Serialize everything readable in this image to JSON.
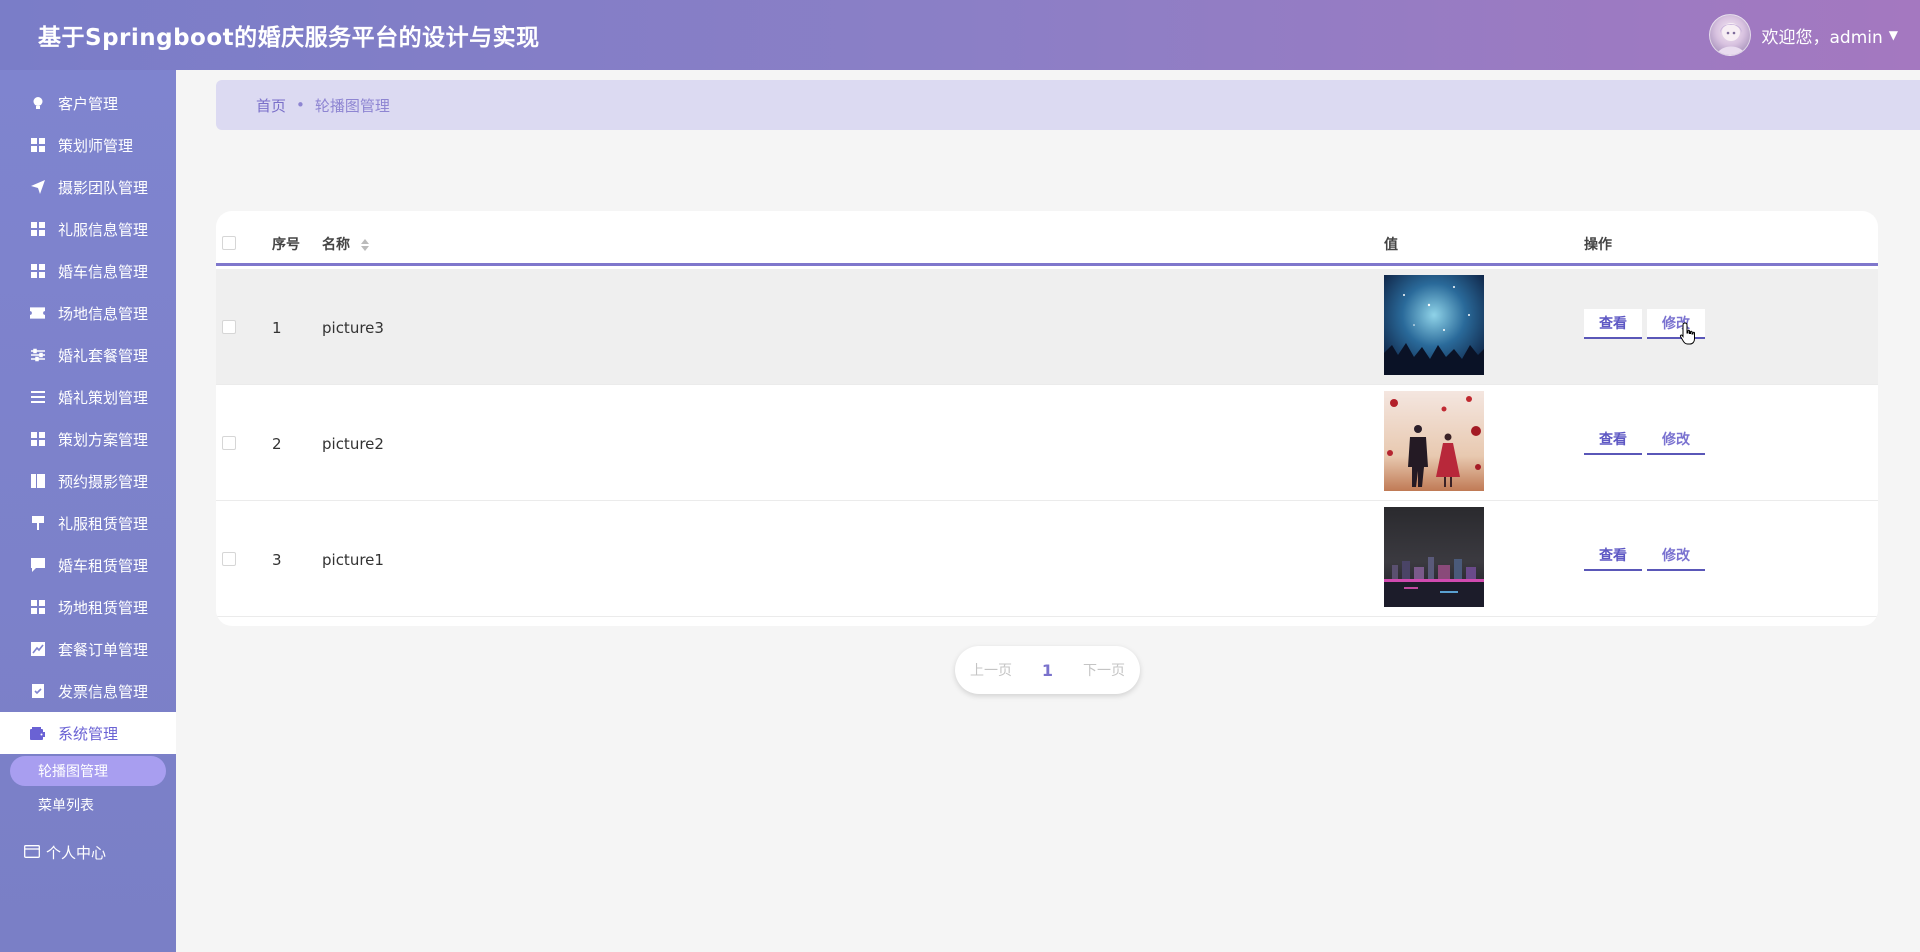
{
  "header": {
    "title": "基于Springboot的婚庆服务平台的设计与实现",
    "welcome": "欢迎您，admin",
    "avatar_icon": "user-avatar-icon"
  },
  "sidebar": {
    "items": [
      {
        "label": "客户管理",
        "icon": "bulb-icon"
      },
      {
        "label": "策划师管理",
        "icon": "grid-icon"
      },
      {
        "label": "摄影团队管理",
        "icon": "send-icon"
      },
      {
        "label": "礼服信息管理",
        "icon": "grid-icon"
      },
      {
        "label": "婚车信息管理",
        "icon": "grid-icon"
      },
      {
        "label": "场地信息管理",
        "icon": "ticket-icon"
      },
      {
        "label": "婚礼套餐管理",
        "icon": "sliders-icon"
      },
      {
        "label": "婚礼策划管理",
        "icon": "list-icon"
      },
      {
        "label": "策划方案管理",
        "icon": "grid-icon"
      },
      {
        "label": "预约摄影管理",
        "icon": "book-icon"
      },
      {
        "label": "礼服租赁管理",
        "icon": "pin-icon"
      },
      {
        "label": "婚车租赁管理",
        "icon": "chat-icon"
      },
      {
        "label": "场地租赁管理",
        "icon": "grid-icon"
      },
      {
        "label": "套餐订单管理",
        "icon": "chart-icon"
      },
      {
        "label": "发票信息管理",
        "icon": "clipboard-icon"
      },
      {
        "label": "系统管理",
        "icon": "wallet-icon"
      }
    ],
    "submenu": [
      "轮播图管理",
      "菜单列表"
    ],
    "personal": "个人中心"
  },
  "breadcrumb": {
    "home": "首页",
    "separator": "•",
    "current": "轮播图管理"
  },
  "table": {
    "headers": {
      "index": "序号",
      "name": "名称",
      "value": "值",
      "action": "操作"
    },
    "rows": [
      {
        "index": "1",
        "name": "picture3",
        "view": "查看",
        "edit": "修改"
      },
      {
        "index": "2",
        "name": "picture2",
        "view": "查看",
        "edit": "修改"
      },
      {
        "index": "3",
        "name": "picture1",
        "view": "查看",
        "edit": "修改"
      }
    ]
  },
  "pager": {
    "prev": "上一页",
    "page": "1",
    "next": "下一页"
  },
  "colors": {
    "accent": "#7f77cc",
    "sidebar": "#7f84cf",
    "active_sub": "#a89ef0"
  }
}
